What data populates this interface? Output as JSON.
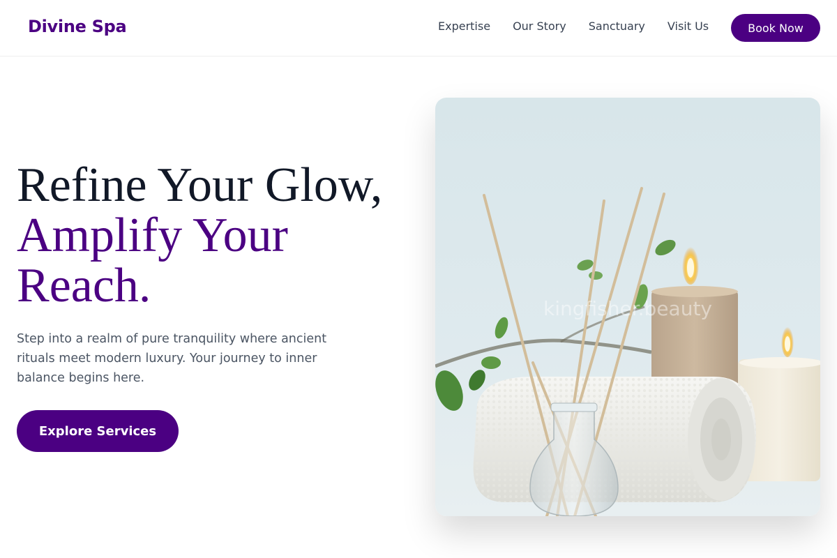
{
  "brand": {
    "name": "Divine Spa"
  },
  "nav": {
    "links": [
      {
        "label": "Expertise"
      },
      {
        "label": "Our Story"
      },
      {
        "label": "Sanctuary"
      },
      {
        "label": "Visit Us"
      }
    ],
    "cta_label": "Book Now"
  },
  "hero": {
    "title_line1": "Refine Your Glow,",
    "title_line2": "Amplify Your",
    "title_line3": "Reach.",
    "description": "Step into a realm of pure tranquility where ancient rituals meet modern luxury. Your journey to inner balance begins here.",
    "cta_label": "Explore Services",
    "image_watermark": "kingfisher.beauty"
  },
  "colors": {
    "accent": "#4b0082",
    "heading": "#111827",
    "body_text": "#4b5563"
  }
}
